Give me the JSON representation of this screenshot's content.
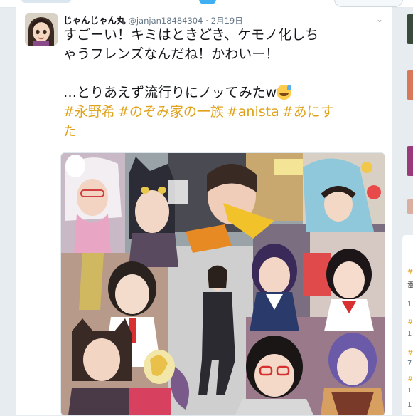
{
  "tweet": {
    "user_name": "じゃんじゃん丸",
    "handle": "@janjan18484304",
    "separator": "·",
    "date": "2月19日",
    "caret": "⌄",
    "text_line1": "すごーい！キミはときどき、ケモノ化しち",
    "text_line2": "ゃうフレンズなんだね！かわいー！",
    "text_line3": "…とりあえず流行りにノッてみたw",
    "emoji_name": "grinning-face-with-sweat-icon",
    "hashtags": [
      "#永野希",
      "#のぞみ家の一族",
      "#anista",
      "#あにす"
    ],
    "hashtag_wrap": "た"
  },
  "right_sidebar": {
    "items": [
      {
        "text": "#",
        "style": "hash"
      },
      {
        "text": "電",
        "style": "dark"
      },
      {
        "text": "1",
        "style": "gray"
      },
      {
        "text": "#",
        "style": "hash"
      },
      {
        "text": "1",
        "style": "gray"
      },
      {
        "text": "#",
        "style": "hash"
      },
      {
        "text": "7",
        "style": "gray"
      },
      {
        "text": "#",
        "style": "hash"
      },
      {
        "text": "1",
        "style": "gray"
      },
      {
        "text": "1",
        "style": "gray"
      }
    ]
  },
  "colors": {
    "hashtag": "#e0a21a",
    "accent": "#1da1f2",
    "text": "#14171a",
    "muted": "#657786",
    "background": "#e6ecf0"
  }
}
